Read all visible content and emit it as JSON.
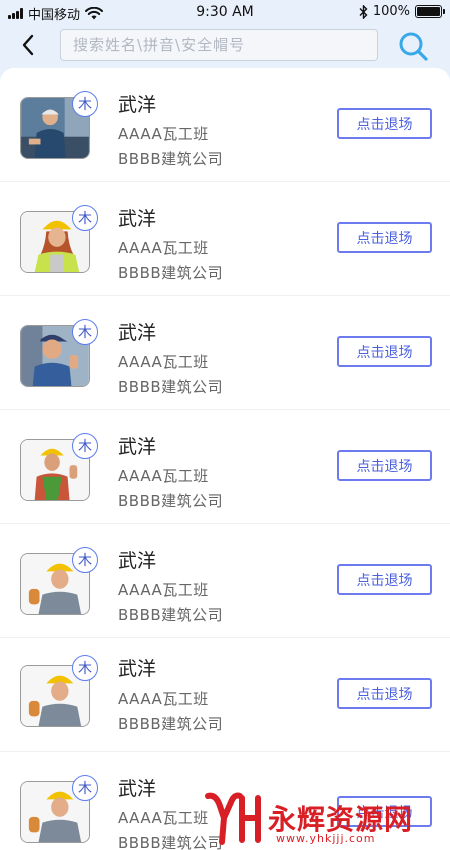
{
  "status_bar": {
    "carrier": "中国移动",
    "time": "9:30 AM",
    "battery": "100%",
    "battery_level": 1.0
  },
  "search": {
    "placeholder": "搜索姓名\\拼音\\安全帽号"
  },
  "workers": [
    {
      "tag": "木",
      "name": "武洋",
      "team": "AAAA瓦工班",
      "company": "BBBB建筑公司",
      "action": "点击退场"
    },
    {
      "tag": "木",
      "name": "武洋",
      "team": "AAAA瓦工班",
      "company": "BBBB建筑公司",
      "action": "点击退场"
    },
    {
      "tag": "木",
      "name": "武洋",
      "team": "AAAA瓦工班",
      "company": "BBBB建筑公司",
      "action": "点击退场"
    },
    {
      "tag": "木",
      "name": "武洋",
      "team": "AAAA瓦工班",
      "company": "BBBB建筑公司",
      "action": "点击退场"
    },
    {
      "tag": "木",
      "name": "武洋",
      "team": "AAAA瓦工班",
      "company": "BBBB建筑公司",
      "action": "点击退场"
    },
    {
      "tag": "木",
      "name": "武洋",
      "team": "AAAA瓦工班",
      "company": "BBBB建筑公司",
      "action": "点击退场"
    },
    {
      "tag": "木",
      "name": "武洋",
      "team": "AAAA瓦工班",
      "company": "BBBB建筑公司",
      "action": "点击退场"
    }
  ],
  "watermark": {
    "text": "永辉资源网",
    "url": "www.yhkjjj.com"
  },
  "colors": {
    "accent": "#5b6ef0",
    "background": "#e8f0fb",
    "search_icon": "#38a8e8",
    "watermark": "#d91f26"
  }
}
